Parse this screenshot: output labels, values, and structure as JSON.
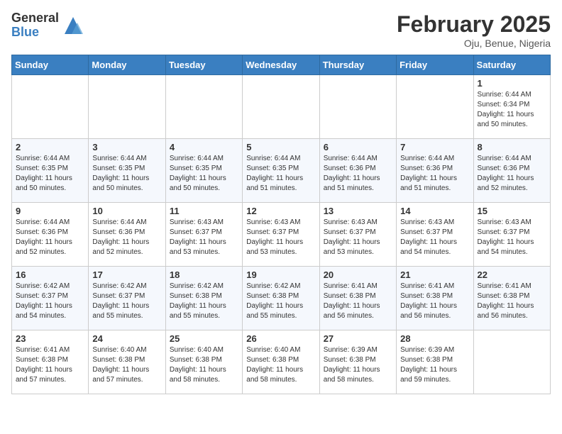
{
  "header": {
    "logo_general": "General",
    "logo_blue": "Blue",
    "month_title": "February 2025",
    "location": "Oju, Benue, Nigeria"
  },
  "days_of_week": [
    "Sunday",
    "Monday",
    "Tuesday",
    "Wednesday",
    "Thursday",
    "Friday",
    "Saturday"
  ],
  "weeks": [
    [
      {
        "day": "",
        "info": ""
      },
      {
        "day": "",
        "info": ""
      },
      {
        "day": "",
        "info": ""
      },
      {
        "day": "",
        "info": ""
      },
      {
        "day": "",
        "info": ""
      },
      {
        "day": "",
        "info": ""
      },
      {
        "day": "1",
        "info": "Sunrise: 6:44 AM\nSunset: 6:34 PM\nDaylight: 11 hours\nand 50 minutes."
      }
    ],
    [
      {
        "day": "2",
        "info": "Sunrise: 6:44 AM\nSunset: 6:35 PM\nDaylight: 11 hours\nand 50 minutes."
      },
      {
        "day": "3",
        "info": "Sunrise: 6:44 AM\nSunset: 6:35 PM\nDaylight: 11 hours\nand 50 minutes."
      },
      {
        "day": "4",
        "info": "Sunrise: 6:44 AM\nSunset: 6:35 PM\nDaylight: 11 hours\nand 50 minutes."
      },
      {
        "day": "5",
        "info": "Sunrise: 6:44 AM\nSunset: 6:35 PM\nDaylight: 11 hours\nand 51 minutes."
      },
      {
        "day": "6",
        "info": "Sunrise: 6:44 AM\nSunset: 6:36 PM\nDaylight: 11 hours\nand 51 minutes."
      },
      {
        "day": "7",
        "info": "Sunrise: 6:44 AM\nSunset: 6:36 PM\nDaylight: 11 hours\nand 51 minutes."
      },
      {
        "day": "8",
        "info": "Sunrise: 6:44 AM\nSunset: 6:36 PM\nDaylight: 11 hours\nand 52 minutes."
      }
    ],
    [
      {
        "day": "9",
        "info": "Sunrise: 6:44 AM\nSunset: 6:36 PM\nDaylight: 11 hours\nand 52 minutes."
      },
      {
        "day": "10",
        "info": "Sunrise: 6:44 AM\nSunset: 6:36 PM\nDaylight: 11 hours\nand 52 minutes."
      },
      {
        "day": "11",
        "info": "Sunrise: 6:43 AM\nSunset: 6:37 PM\nDaylight: 11 hours\nand 53 minutes."
      },
      {
        "day": "12",
        "info": "Sunrise: 6:43 AM\nSunset: 6:37 PM\nDaylight: 11 hours\nand 53 minutes."
      },
      {
        "day": "13",
        "info": "Sunrise: 6:43 AM\nSunset: 6:37 PM\nDaylight: 11 hours\nand 53 minutes."
      },
      {
        "day": "14",
        "info": "Sunrise: 6:43 AM\nSunset: 6:37 PM\nDaylight: 11 hours\nand 54 minutes."
      },
      {
        "day": "15",
        "info": "Sunrise: 6:43 AM\nSunset: 6:37 PM\nDaylight: 11 hours\nand 54 minutes."
      }
    ],
    [
      {
        "day": "16",
        "info": "Sunrise: 6:42 AM\nSunset: 6:37 PM\nDaylight: 11 hours\nand 54 minutes."
      },
      {
        "day": "17",
        "info": "Sunrise: 6:42 AM\nSunset: 6:37 PM\nDaylight: 11 hours\nand 55 minutes."
      },
      {
        "day": "18",
        "info": "Sunrise: 6:42 AM\nSunset: 6:38 PM\nDaylight: 11 hours\nand 55 minutes."
      },
      {
        "day": "19",
        "info": "Sunrise: 6:42 AM\nSunset: 6:38 PM\nDaylight: 11 hours\nand 55 minutes."
      },
      {
        "day": "20",
        "info": "Sunrise: 6:41 AM\nSunset: 6:38 PM\nDaylight: 11 hours\nand 56 minutes."
      },
      {
        "day": "21",
        "info": "Sunrise: 6:41 AM\nSunset: 6:38 PM\nDaylight: 11 hours\nand 56 minutes."
      },
      {
        "day": "22",
        "info": "Sunrise: 6:41 AM\nSunset: 6:38 PM\nDaylight: 11 hours\nand 56 minutes."
      }
    ],
    [
      {
        "day": "23",
        "info": "Sunrise: 6:41 AM\nSunset: 6:38 PM\nDaylight: 11 hours\nand 57 minutes."
      },
      {
        "day": "24",
        "info": "Sunrise: 6:40 AM\nSunset: 6:38 PM\nDaylight: 11 hours\nand 57 minutes."
      },
      {
        "day": "25",
        "info": "Sunrise: 6:40 AM\nSunset: 6:38 PM\nDaylight: 11 hours\nand 58 minutes."
      },
      {
        "day": "26",
        "info": "Sunrise: 6:40 AM\nSunset: 6:38 PM\nDaylight: 11 hours\nand 58 minutes."
      },
      {
        "day": "27",
        "info": "Sunrise: 6:39 AM\nSunset: 6:38 PM\nDaylight: 11 hours\nand 58 minutes."
      },
      {
        "day": "28",
        "info": "Sunrise: 6:39 AM\nSunset: 6:38 PM\nDaylight: 11 hours\nand 59 minutes."
      },
      {
        "day": "",
        "info": ""
      }
    ]
  ]
}
